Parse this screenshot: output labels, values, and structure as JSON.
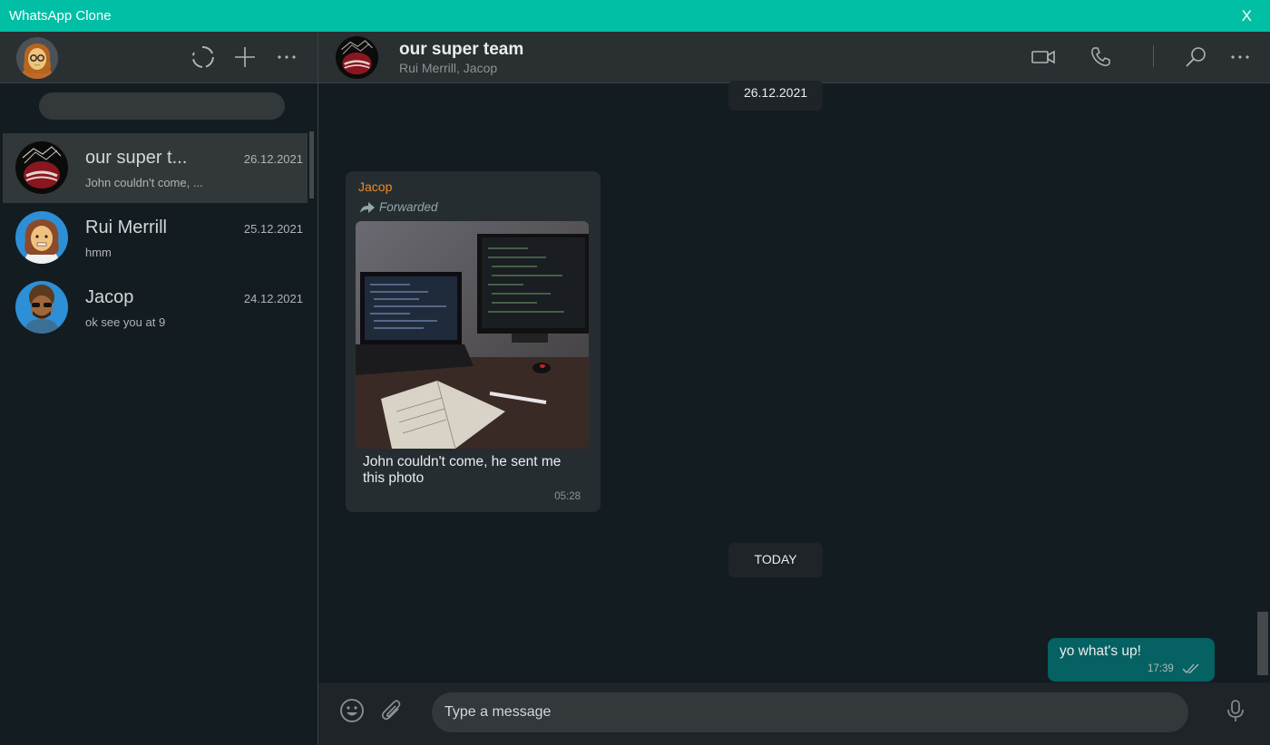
{
  "window": {
    "title": "WhatsApp Clone",
    "close_label": "X"
  },
  "sidebar": {
    "search_placeholder": "",
    "chats": [
      {
        "name": "our super t...",
        "date": "26.12.2021",
        "preview": "John couldn't come, ...",
        "active": true
      },
      {
        "name": "Rui Merrill",
        "date": "25.12.2021",
        "preview": "hmm",
        "active": false
      },
      {
        "name": "Jacop",
        "date": "24.12.2021",
        "preview": "ok see you at 9",
        "active": false
      }
    ]
  },
  "chat": {
    "title": "our super team",
    "subtitle": "Rui Merrill, Jacop",
    "date_chip_1": "26.12.2021",
    "date_chip_2": "TODAY",
    "incoming": {
      "sender": "Jacop",
      "forwarded_label": "Forwarded",
      "text": "John couldn't come, he sent me this photo",
      "time": "05:28"
    },
    "outgoing": {
      "text": "yo what's up!",
      "time": "17:39"
    }
  },
  "composer": {
    "placeholder": "Type a message"
  },
  "colors": {
    "accent": "#00bfa5",
    "panel": "#2a2f32",
    "background": "#131c21",
    "outgoing_bubble": "#056162",
    "incoming_bubble": "#262d31",
    "sender_name": "#ef8a29"
  }
}
